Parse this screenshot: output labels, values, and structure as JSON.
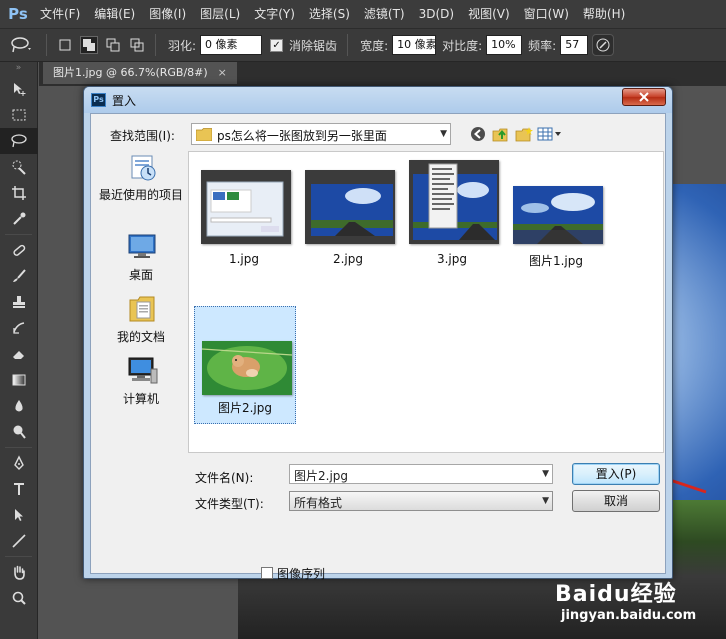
{
  "app": {
    "logo": "Ps",
    "menu": [
      "文件(F)",
      "编辑(E)",
      "图像(I)",
      "图层(L)",
      "文字(Y)",
      "选择(S)",
      "滤镜(T)",
      "3D(D)",
      "视图(V)",
      "窗口(W)",
      "帮助(H)"
    ]
  },
  "options": {
    "feather_label": "羽化:",
    "feather_value": "0 像素",
    "antialias_label": "消除锯齿",
    "antialias_checked": true,
    "width_label": "宽度:",
    "width_value": "10 像素",
    "contrast_label": "对比度:",
    "contrast_value": "10%",
    "frequency_label": "频率:",
    "frequency_value": "57"
  },
  "document": {
    "tab_title": "图片1.jpg @ 66.7%(RGB/8#)",
    "tab_close": "×"
  },
  "dialog": {
    "title": "置入",
    "look_in_label": "查找范围(I):",
    "look_in_value": "ps怎么将一张图放到另一张里面",
    "places": [
      {
        "label": "最近使用的项目",
        "icon": "recent-items-icon"
      },
      {
        "label": "桌面",
        "icon": "desktop-icon"
      },
      {
        "label": "我的文档",
        "icon": "my-documents-icon"
      },
      {
        "label": "计算机",
        "icon": "computer-icon"
      }
    ],
    "files": [
      {
        "name": "1.jpg",
        "selected": false
      },
      {
        "name": "2.jpg",
        "selected": false
      },
      {
        "name": "3.jpg",
        "selected": false
      },
      {
        "name": "图片1.jpg",
        "selected": false
      },
      {
        "name": "图片2.jpg",
        "selected": true
      }
    ],
    "filename_label": "文件名(N):",
    "filename_value": "图片2.jpg",
    "filetype_label": "文件类型(T):",
    "filetype_value": "所有格式",
    "place_button": "置入(P)",
    "cancel_button": "取消",
    "image_sequence_label": "图像序列",
    "image_sequence_checked": false
  },
  "watermark": {
    "logo": "Baidu经验",
    "url": "jingyan.baidu.com"
  },
  "colors": {
    "accent_red": "#d7261e",
    "dialog_frame": "#bcd3ea",
    "ps_dark": "#3c3c3c"
  }
}
